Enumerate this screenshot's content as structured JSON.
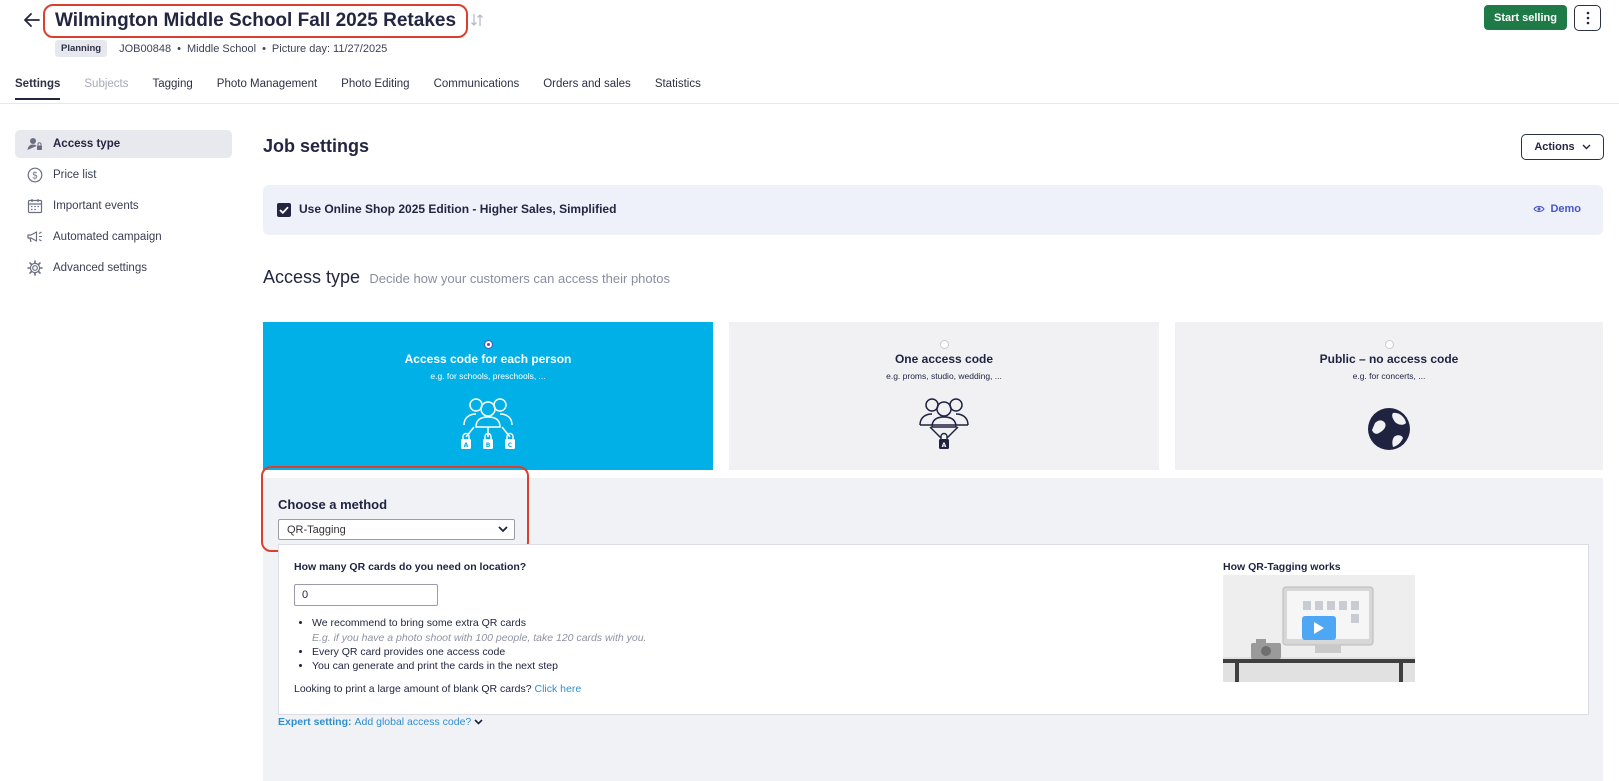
{
  "header": {
    "title": "Wilmington Middle School Fall 2025 Retakes",
    "status_badge": "Planning",
    "job_id": "JOB00848",
    "school_type": "Middle School",
    "picture_day": "Picture day: 11/27/2025",
    "start_selling_label": "Start selling"
  },
  "tabs": [
    {
      "label": "Settings",
      "state": "active"
    },
    {
      "label": "Subjects",
      "state": "disabled"
    },
    {
      "label": "Tagging",
      "state": "normal"
    },
    {
      "label": "Photo Management",
      "state": "normal"
    },
    {
      "label": "Photo Editing",
      "state": "normal"
    },
    {
      "label": "Communications",
      "state": "normal"
    },
    {
      "label": "Orders and sales",
      "state": "normal"
    },
    {
      "label": "Statistics",
      "state": "normal"
    }
  ],
  "sidebar": {
    "items": [
      {
        "label": "Access type",
        "icon": "user-lock-icon",
        "active": true
      },
      {
        "label": "Price list",
        "icon": "dollar-circle-icon",
        "active": false
      },
      {
        "label": "Important events",
        "icon": "calendar-icon",
        "active": false
      },
      {
        "label": "Automated campaign",
        "icon": "megaphone-icon",
        "active": false
      },
      {
        "label": "Advanced settings",
        "icon": "gear-icon",
        "active": false
      }
    ]
  },
  "main": {
    "title": "Job settings",
    "actions_label": "Actions",
    "online_shop": {
      "label": "Use Online Shop 2025 Edition - Higher Sales, Simplified",
      "checked": true,
      "demo_label": "Demo"
    },
    "access_type": {
      "heading": "Access type",
      "subheading": "Decide how your customers can access their photos",
      "options": [
        {
          "title": "Access code for each person",
          "subtitle": "e.g. for schools, preschools, ...",
          "selected": true,
          "icon": "group-multiple-codes-icon"
        },
        {
          "title": "One access code",
          "subtitle": "e.g. proms, studio, wedding, ...",
          "selected": false,
          "icon": "group-single-code-icon"
        },
        {
          "title": "Public – no access code",
          "subtitle": "e.g. for concerts, ...",
          "selected": false,
          "icon": "globe-icon"
        }
      ]
    },
    "method": {
      "title": "Choose a method",
      "selected": "QR-Tagging",
      "qr": {
        "question": "How many QR cards do you need on location?",
        "value": "0",
        "bullets": [
          "We recommend to bring some extra QR cards",
          "Every QR card provides one access code",
          "You can generate and print the cards in the next step"
        ],
        "example": "E.g. if you have a photo shoot with 100 people, take 120 cards with you.",
        "blank_question": "Looking to print a large amount of blank QR cards?",
        "click_here": "Click here",
        "how_title": "How QR-Tagging works"
      },
      "expert_key": "Expert setting:",
      "expert_value": "Add global access code?"
    }
  },
  "colors": {
    "selected_card": "#00b0e6",
    "start_selling": "#1e7a46",
    "highlight_outline": "#d9412e",
    "link": "#2f8fce"
  }
}
